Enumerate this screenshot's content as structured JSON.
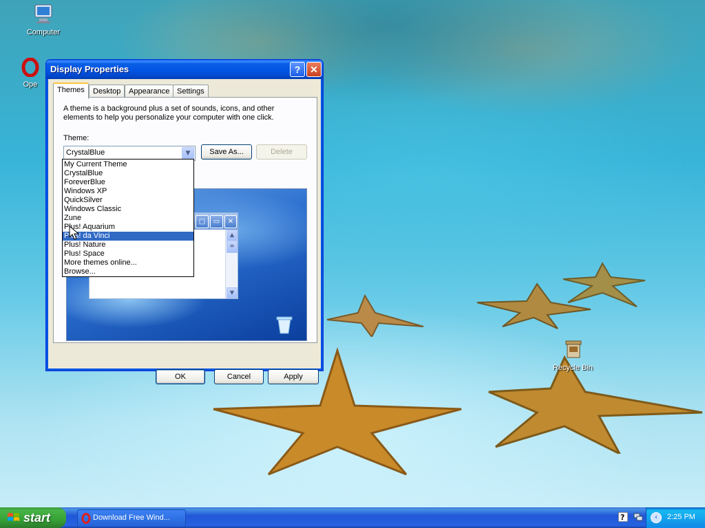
{
  "desktop": {
    "icons": [
      {
        "label": "Computer"
      },
      {
        "label": "Ope"
      },
      {
        "label": "Recycle Bin"
      }
    ]
  },
  "window": {
    "title": "Display Properties",
    "help_label": "?",
    "close_label": "✕",
    "tabs": [
      "Themes",
      "Desktop",
      "Appearance",
      "Settings"
    ],
    "active_tab": "Themes",
    "description": "A theme is a background plus a set of sounds, icons, and other elements to help you personalize your computer with one click.",
    "theme_label": "Theme:",
    "theme_value": "CrystalBlue",
    "save_as_label": "Save As...",
    "delete_label": "Delete",
    "dropdown_options": [
      "My Current Theme",
      "CrystalBlue",
      "ForeverBlue",
      "Windows XP",
      "QuickSilver",
      "Windows Classic",
      "Zune",
      "Plus! Aquarium",
      "Plus! da Vinci",
      "Plus! Nature",
      "Plus! Space",
      "More themes online...",
      "Browse..."
    ],
    "highlighted_option": "Plus! da Vinci",
    "ok_label": "OK",
    "cancel_label": "Cancel",
    "apply_label": "Apply"
  },
  "taskbar": {
    "start_label": "start",
    "task_label": "Download Free Wind...",
    "clock": "2:25 PM"
  },
  "colors": {
    "selection": "#316ac5",
    "title_bar": "#0054e3",
    "start_green": "#36a136"
  }
}
